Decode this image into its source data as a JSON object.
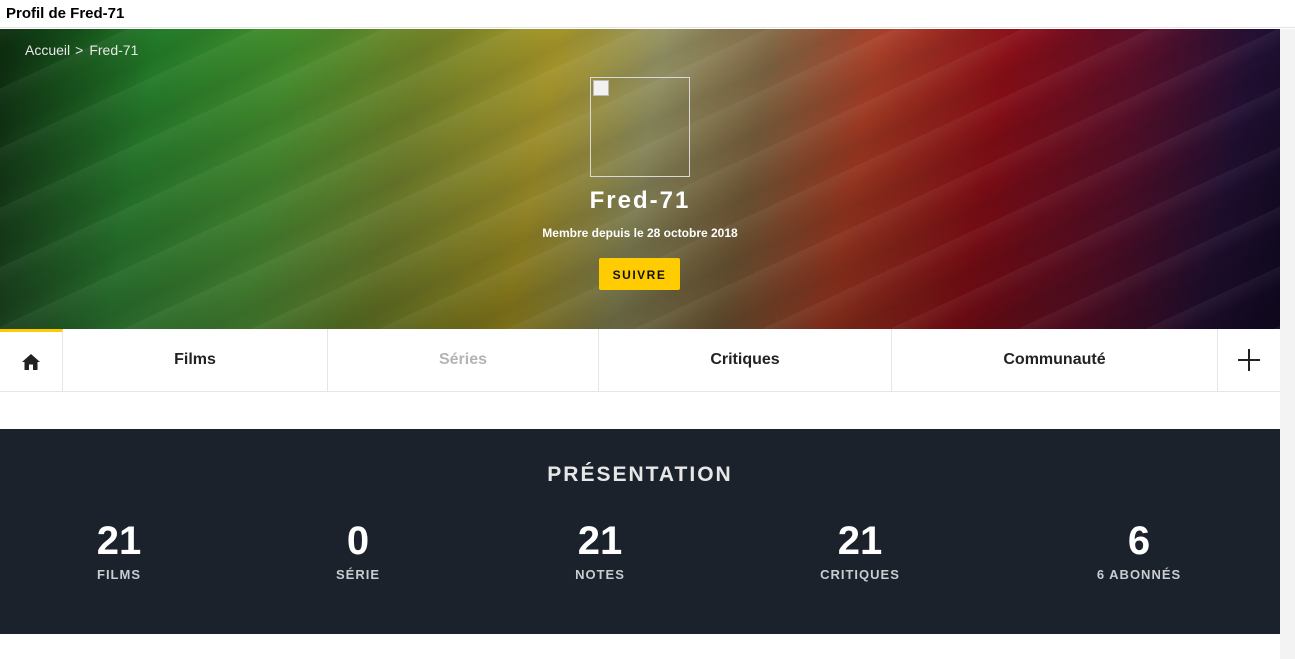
{
  "window": {
    "title": "Profil de Fred-71"
  },
  "breadcrumb": {
    "home": "Accueil",
    "separator": ">",
    "current": "Fred-71"
  },
  "profile": {
    "username": "Fred-71",
    "member_since": "Membre depuis le 28 octobre 2018",
    "follow_label": "SUIVRE"
  },
  "tabs": {
    "home_icon": "home-icon",
    "items": [
      {
        "label": "Films"
      },
      {
        "label": "Séries"
      },
      {
        "label": "Critiques"
      },
      {
        "label": "Communauté"
      }
    ],
    "more_icon": "plus-icon"
  },
  "presentation": {
    "title": "PRÉSENTATION",
    "stats": [
      {
        "value": "21",
        "label": "FILMS"
      },
      {
        "value": "0",
        "label": "SÉRIE"
      },
      {
        "value": "21",
        "label": "NOTES"
      },
      {
        "value": "21",
        "label": "CRITIQUES"
      },
      {
        "value": "6",
        "label": "6 ABONNÉS"
      }
    ]
  },
  "colors": {
    "accent": "#fecc00",
    "presentation_bg": "#1b222b"
  }
}
